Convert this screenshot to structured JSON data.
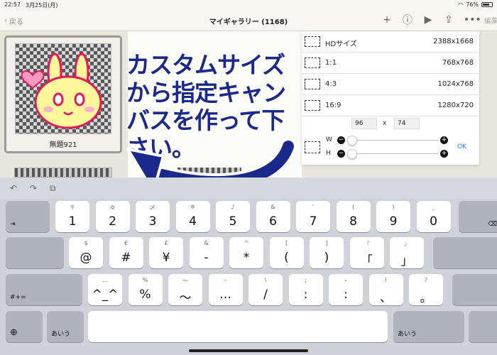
{
  "status": {
    "time": "22:57",
    "date": "3月25日(月)",
    "battery": "76%",
    "battery_level": 0.76
  },
  "nav": {
    "back_label": "戻る",
    "title": "マイギャラリー (1168)",
    "add_icon": "plus-icon",
    "info_icon": "info-icon",
    "play_icon": "play-icon",
    "share_icon": "share-icon",
    "more_icon": "more-icon",
    "edit_label": "編集"
  },
  "gallery": {
    "thumb_caption": "無題921"
  },
  "panel": {
    "presets": [
      {
        "label": "HDサイズ",
        "size": "2388x1668"
      },
      {
        "label": "1:1",
        "size": "768x768"
      },
      {
        "label": "4:3",
        "size": "1024x768"
      },
      {
        "label": "16:9",
        "size": "1280x720"
      }
    ],
    "custom_width": "96",
    "custom_x": "x",
    "custom_height": "74",
    "w_label": "W",
    "h_label": "H",
    "minus": "−",
    "plus": "+",
    "ok_label": "OK"
  },
  "annotation": {
    "text": "カスタムサイズから指定キャンバスを作って下さい。"
  },
  "keyboard": {
    "undo_icon": "undo-icon",
    "redo_icon": "redo-icon",
    "paste_icon": "paste-icon",
    "row1": [
      {
        "sub": "〒",
        "main": "1"
      },
      {
        "sub": "々",
        "main": "2"
      },
      {
        "sub": "〆",
        "main": "3"
      },
      {
        "sub": "※",
        "main": "4"
      },
      {
        "sub": "♪",
        "main": "5"
      },
      {
        "sub": "&",
        "main": "6"
      },
      {
        "sub": "'",
        "main": "7"
      },
      {
        "sub": "(",
        "main": "8"
      },
      {
        "sub": ")",
        "main": "9"
      },
      {
        "sub": "_",
        "main": "0"
      }
    ],
    "row2": [
      {
        "sub": "$",
        "main": "@"
      },
      {
        "sub": "€",
        "main": "#"
      },
      {
        "sub": "£",
        "main": "¥"
      },
      {
        "sub": "&",
        "main": "-"
      },
      {
        "sub": "^",
        "main": "*"
      },
      {
        "sub": "[",
        "main": "("
      },
      {
        "sub": "]",
        "main": ")"
      },
      {
        "sub": "『",
        "main": "「"
      },
      {
        "sub": "』",
        "main": "」"
      }
    ],
    "row3": [
      {
        "sub": "…",
        "main": "^_^"
      },
      {
        "sub": "%",
        "main": "%"
      },
      {
        "sub": "〜",
        "main": "〜"
      },
      {
        "sub": "–",
        "main": "…"
      },
      {
        "sub": "\\",
        "main": "/"
      },
      {
        "sub": ";",
        "main": ":"
      },
      {
        "sub": "・",
        "main": ":"
      },
      {
        "sub": "!",
        "main": "、"
      },
      {
        "sub": "?",
        "main": "。"
      }
    ],
    "tab_label": "⇥",
    "delete_icon": "delete-icon",
    "shift_label": "#+=",
    "globe_icon": "globe-icon",
    "lang_label": "あいう",
    "lang_label_right": "あいう"
  }
}
